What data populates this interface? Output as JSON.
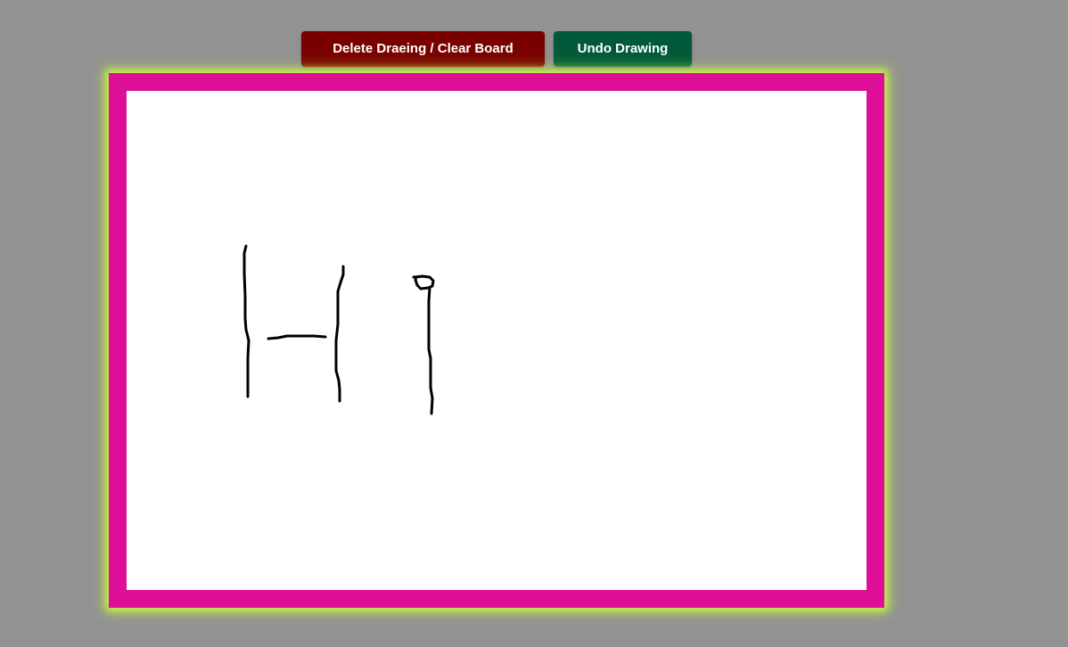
{
  "toolbar": {
    "clear_label": "Delete Draeing / Clear Board",
    "undo_label": "Undo Drawing"
  },
  "colors": {
    "background": "#929292",
    "board_border": "#dc0f96",
    "board_glow": "#c8f54a",
    "canvas": "#ffffff",
    "clear_button": "#7a0000",
    "undo_button": "#005a3a",
    "ink": "#000000"
  }
}
